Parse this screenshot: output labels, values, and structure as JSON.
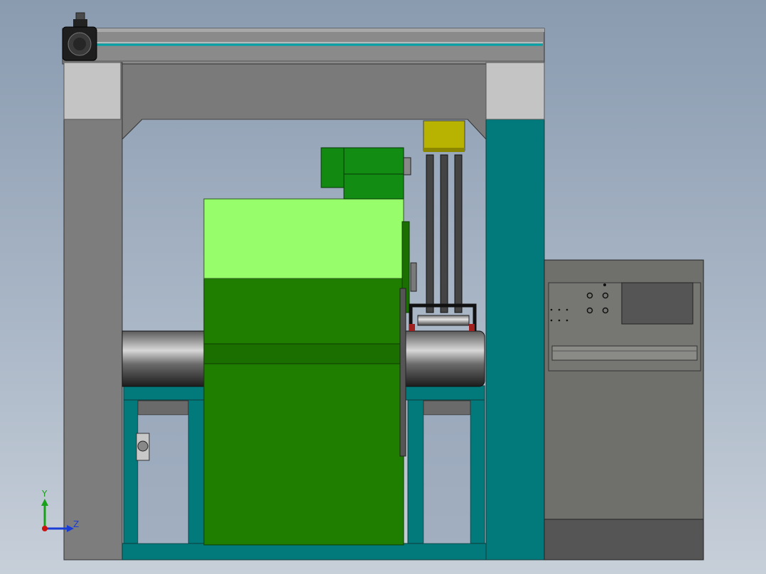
{
  "viewport": {
    "background_top": "#8a9bb0",
    "background_bottom": "#c7cfd9"
  },
  "model_colors": {
    "frame_gray": "#7a7a7a",
    "frame_light": "#c3c3c3",
    "teal": "#02797a",
    "bright_green": "#97fd6a",
    "mid_green": "#1f8000",
    "dark_green": "#128c12",
    "yellow": "#b8b300",
    "cabinet": "#6f6f6b",
    "cabinet_base": "#555555",
    "roller_dark": "#333333"
  },
  "triad": {
    "y_label": "Y",
    "z_label": "Z",
    "y_color": "#1aa01a",
    "z_color": "#1a3dd6",
    "origin_color": "#cc1111"
  }
}
